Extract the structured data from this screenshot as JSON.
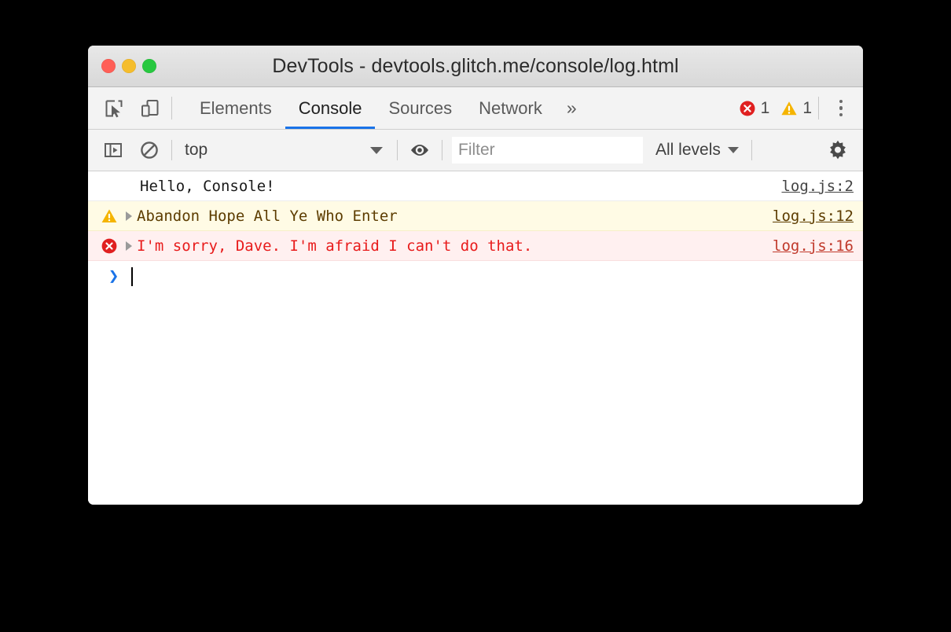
{
  "window": {
    "title": "DevTools - devtools.glitch.me/console/log.html",
    "traffic_lights": [
      {
        "name": "close",
        "color": "#ff5f57"
      },
      {
        "name": "minimize",
        "color": "#f5bd2d"
      },
      {
        "name": "zoom",
        "color": "#28c840"
      }
    ]
  },
  "tabbar": {
    "inspect_icon": "inspect-element-icon",
    "device_icon": "device-toolbar-icon",
    "tabs": [
      {
        "label": "Elements",
        "active": false
      },
      {
        "label": "Console",
        "active": true
      },
      {
        "label": "Sources",
        "active": false
      },
      {
        "label": "Network",
        "active": false
      }
    ],
    "more_tabs_label": "»",
    "error_count": "1",
    "warning_count": "1",
    "error_icon": "error-circle-icon",
    "warning_icon": "warning-triangle-icon",
    "menu_icon": "kebab-menu-icon",
    "accent_color": "#1a73e8"
  },
  "console_toolbar": {
    "sidebar_icon": "console-sidebar-icon",
    "clear_icon": "clear-console-icon",
    "context": "top",
    "eye_icon": "live-expression-eye-icon",
    "filter": {
      "value": "",
      "placeholder": "Filter"
    },
    "levels": "All levels",
    "settings_icon": "settings-gear-icon"
  },
  "console_messages": [
    {
      "level": "log",
      "text": "Hello, Console!",
      "source": "log.js:2",
      "has_icon": false,
      "has_arrow": false
    },
    {
      "level": "warning",
      "text": "Abandon Hope All Ye Who Enter",
      "source": "log.js:12",
      "has_icon": true,
      "has_arrow": true
    },
    {
      "level": "error",
      "text": "I'm sorry, Dave. I'm afraid I can't do that.",
      "source": "log.js:16",
      "has_icon": true,
      "has_arrow": true
    }
  ],
  "prompt": {
    "chevron": "❯",
    "value": ""
  },
  "colors": {
    "log_bg": "#ffffff",
    "warning_bg": "#fffbe5",
    "warning_text": "#5c3c00",
    "error_bg": "#fff0f0",
    "error_text": "#e81b1b",
    "accent": "#1a73e8"
  }
}
